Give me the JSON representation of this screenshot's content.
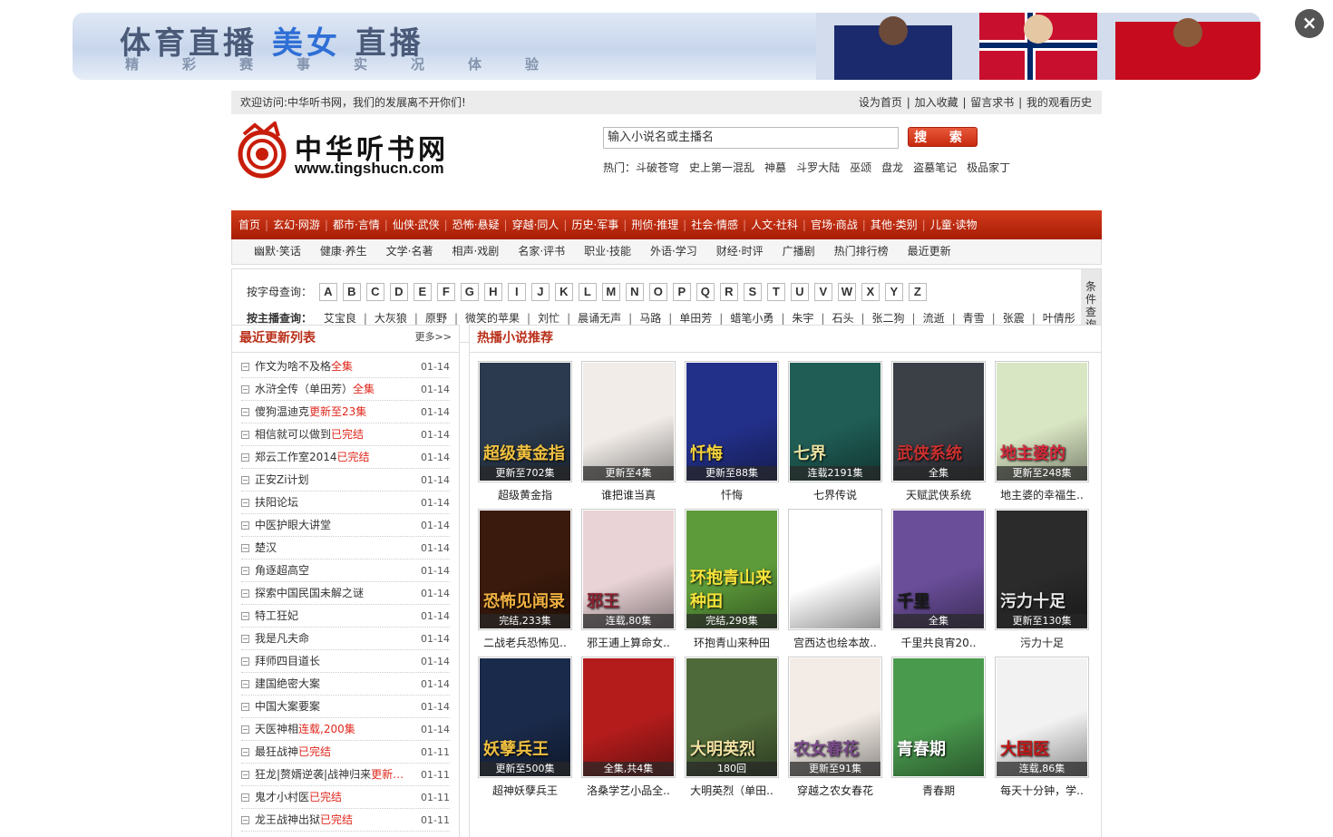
{
  "banner": {
    "title_a": "体育直播",
    "title_b": "美女",
    "title_c": "直播",
    "subtitle": "精彩赛事实况体验"
  },
  "close_label": "×",
  "topbar": {
    "welcome": "欢迎访问:中华听书网，我们的发展离不开你们!",
    "links": [
      "设为首页",
      "加入收藏",
      "留言求书",
      "我的观看历史"
    ]
  },
  "logo": {
    "name": "中华听书网",
    "url": "www.tingshucn.com"
  },
  "search": {
    "placeholder": "输入小说名或主播名",
    "button": "搜 索"
  },
  "hot": {
    "label": "热门：",
    "items": [
      "斗破苍穹",
      "史上第一混乱",
      "神墓",
      "斗罗大陆",
      "巫颂",
      "盘龙",
      "盗墓笔记",
      "极品家丁"
    ]
  },
  "nav": [
    "首页",
    "玄幻·网游",
    "都市·言情",
    "仙侠·武侠",
    "恐怖·悬疑",
    "穿越·同人",
    "历史·军事",
    "刑侦·推理",
    "社会·情感",
    "人文·社科",
    "官场·商战",
    "其他·类别",
    "儿童·读物"
  ],
  "subnav": [
    "幽默·笑话",
    "健康·养生",
    "文学·名著",
    "相声·戏剧",
    "名家·评书",
    "职业·技能",
    "外语·学习",
    "财经·时评",
    "广播剧",
    "热门排行榜",
    "最近更新"
  ],
  "filter": {
    "letter_label": "按字母查询：",
    "letters": [
      "A",
      "B",
      "C",
      "D",
      "E",
      "F",
      "G",
      "H",
      "I",
      "J",
      "K",
      "L",
      "M",
      "N",
      "O",
      "P",
      "Q",
      "R",
      "S",
      "T",
      "U",
      "V",
      "W",
      "X",
      "Y",
      "Z"
    ],
    "anchor_label": "按主播查询：",
    "anchors": [
      "艾宝良",
      "大灰狼",
      "原野",
      "微笑的苹果",
      "刘忙",
      "晨诵无声",
      "马路",
      "单田芳",
      "蜡笔小勇",
      "朱宇",
      "石头",
      "张二狗",
      "流逝",
      "青雪",
      "张震",
      "叶倩彤"
    ],
    "side": "条件查询"
  },
  "recent": {
    "title": "最近更新列表",
    "more": "更多>>",
    "items": [
      {
        "name": "作文为啥不及格",
        "status": "全集",
        "date": "01-14"
      },
      {
        "name": "水浒全传（单田芳）",
        "status": "全集",
        "date": "01-14"
      },
      {
        "name": "傻狗温迪克",
        "status": "更新至23集",
        "date": "01-14"
      },
      {
        "name": "相信就可以做到",
        "status": "已完结",
        "date": "01-14"
      },
      {
        "name": "郑云工作室2014",
        "status": "已完结",
        "date": "01-14"
      },
      {
        "name": "正安Zi计划",
        "status": "",
        "date": "01-14"
      },
      {
        "name": "扶阳论坛",
        "status": "",
        "date": "01-14"
      },
      {
        "name": "中医护眼大讲堂",
        "status": "",
        "date": "01-14"
      },
      {
        "name": "楚汉",
        "status": "",
        "date": "01-14"
      },
      {
        "name": "角逐超高空",
        "status": "",
        "date": "01-14"
      },
      {
        "name": "探索中国民国未解之谜",
        "status": "",
        "date": "01-14"
      },
      {
        "name": "特工狂妃",
        "status": "",
        "date": "01-14"
      },
      {
        "name": "我是凡夫命",
        "status": "",
        "date": "01-14"
      },
      {
        "name": "拜师四目道长",
        "status": "",
        "date": "01-14"
      },
      {
        "name": "建国绝密大案",
        "status": "",
        "date": "01-14"
      },
      {
        "name": "中国大案要案",
        "status": "",
        "date": "01-14"
      },
      {
        "name": "天医神相",
        "status": "连载,200集",
        "date": "01-14"
      },
      {
        "name": "最狂战神",
        "status": "已完结",
        "date": "01-11"
      },
      {
        "name": "狂龙|赘婿逆袭|战神归来",
        "status": "更新…",
        "date": "01-11"
      },
      {
        "name": "鬼才小村医",
        "status": "已完结",
        "date": "01-11"
      },
      {
        "name": "龙王战神出狱",
        "status": "已完结",
        "date": "01-11"
      }
    ]
  },
  "hot_novels": {
    "title": "热播小说推荐",
    "items": [
      {
        "title": "超级黄金指",
        "badge": "更新至702集",
        "bg": "#2b3a4e",
        "fg": "#f0c040",
        "cover_text": "超级黄金指"
      },
      {
        "title": "谁把谁当真",
        "badge": "更新至4集",
        "bg": "#f1ece8",
        "fg": "#b01010",
        "cover_text": ""
      },
      {
        "title": "忏悔",
        "badge": "更新至88集",
        "bg": "#23308a",
        "fg": "#f2d23a",
        "cover_text": "忏悔"
      },
      {
        "title": "七界传说",
        "badge": "连载2191集",
        "bg": "#1f5d55",
        "fg": "#e8e0a0",
        "cover_text": "七界"
      },
      {
        "title": "天赋武侠系统",
        "badge": "全集",
        "bg": "#3b3f46",
        "fg": "#c93030",
        "cover_text": "武侠系统"
      },
      {
        "title": "地主婆的幸福生..",
        "badge": "更新至248集",
        "bg": "#d9e6c3",
        "fg": "#d4283a",
        "cover_text": "地主婆的"
      },
      {
        "title": "二战老兵恐怖见..",
        "badge": "完结,233集",
        "bg": "#3a1a0c",
        "fg": "#f0b040",
        "cover_text": "恐怖见闻录"
      },
      {
        "title": "邪王逋上算命女..",
        "badge": "连载,80集",
        "bg": "#e9d3d6",
        "fg": "#8a2030",
        "cover_text": "邪王"
      },
      {
        "title": "环抱青山来种田",
        "badge": "完结,298集",
        "bg": "#5c9a3a",
        "fg": "#f7e43a",
        "cover_text": "环抱青山来种田"
      },
      {
        "title": "宫西达也绘本故..",
        "badge": "",
        "bg": "#ffffff",
        "fg": "#1e6a35",
        "cover_text": ""
      },
      {
        "title": "千里共良宵20..",
        "badge": "全集",
        "bg": "#6a4e9a",
        "fg": "#1a1a1a",
        "cover_text": "千里"
      },
      {
        "title": "污力十足",
        "badge": "更新至130集",
        "bg": "#2b2b2b",
        "fg": "#e8e8e8",
        "cover_text": "污力十足"
      },
      {
        "title": "超神妖孽兵王",
        "badge": "更新至500集",
        "bg": "#1a2a4a",
        "fg": "#f0c040",
        "cover_text": "妖孽兵王"
      },
      {
        "title": "洛桑学艺小品全..",
        "badge": "全集,共4集",
        "bg": "#b41c1c",
        "fg": "#f3d24a",
        "cover_text": ""
      },
      {
        "title": "大明英烈（单田..",
        "badge": "180回",
        "bg": "#4f6a3a",
        "fg": "#f0e0a0",
        "cover_text": "大明英烈"
      },
      {
        "title": "穿越之农女春花",
        "badge": "更新至91集",
        "bg": "#f3ece6",
        "fg": "#7a4a8a",
        "cover_text": "农女春花"
      },
      {
        "title": "青春期",
        "badge": "",
        "bg": "#4a9a4e",
        "fg": "#ffffff",
        "cover_text": "青春期"
      },
      {
        "title": "每天十分钟，学..",
        "badge": "连载,86集",
        "bg": "#f2f2f2",
        "fg": "#c01818",
        "cover_text": "大国医"
      }
    ]
  },
  "colors": {
    "accent": "#b9301a",
    "nav": "#c1300f",
    "status_red": "#e0281d"
  }
}
